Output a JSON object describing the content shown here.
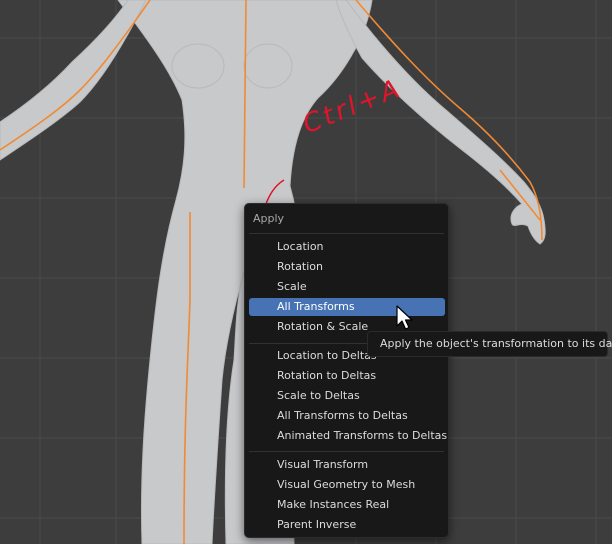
{
  "annotation": {
    "text": "Ctrl+A"
  },
  "menu": {
    "title": "Apply",
    "groups": [
      {
        "items": [
          "Location",
          "Rotation",
          "Scale",
          "All Transforms",
          "Rotation & Scale"
        ]
      },
      {
        "items": [
          "Location to Deltas",
          "Rotation to Deltas",
          "Scale to Deltas",
          "All Transforms to Deltas",
          "Animated Transforms to Deltas"
        ]
      },
      {
        "items": [
          "Visual Transform",
          "Visual Geometry to Mesh",
          "Make Instances Real",
          "Parent Inverse"
        ]
      }
    ],
    "highlighted_item": "All Transforms"
  },
  "tooltip": {
    "text": "Apply the object's transformation to its data."
  },
  "icons": {
    "cursor": "mouse-pointer-icon"
  },
  "colors": {
    "viewport_bg": "#3d3d3d",
    "grid": "#4a4a4a",
    "body": "#c8c9cb",
    "seam": "#f08a35",
    "menu_bg": "#181818",
    "highlight": "#4772b3",
    "annotation": "#e0142a"
  }
}
